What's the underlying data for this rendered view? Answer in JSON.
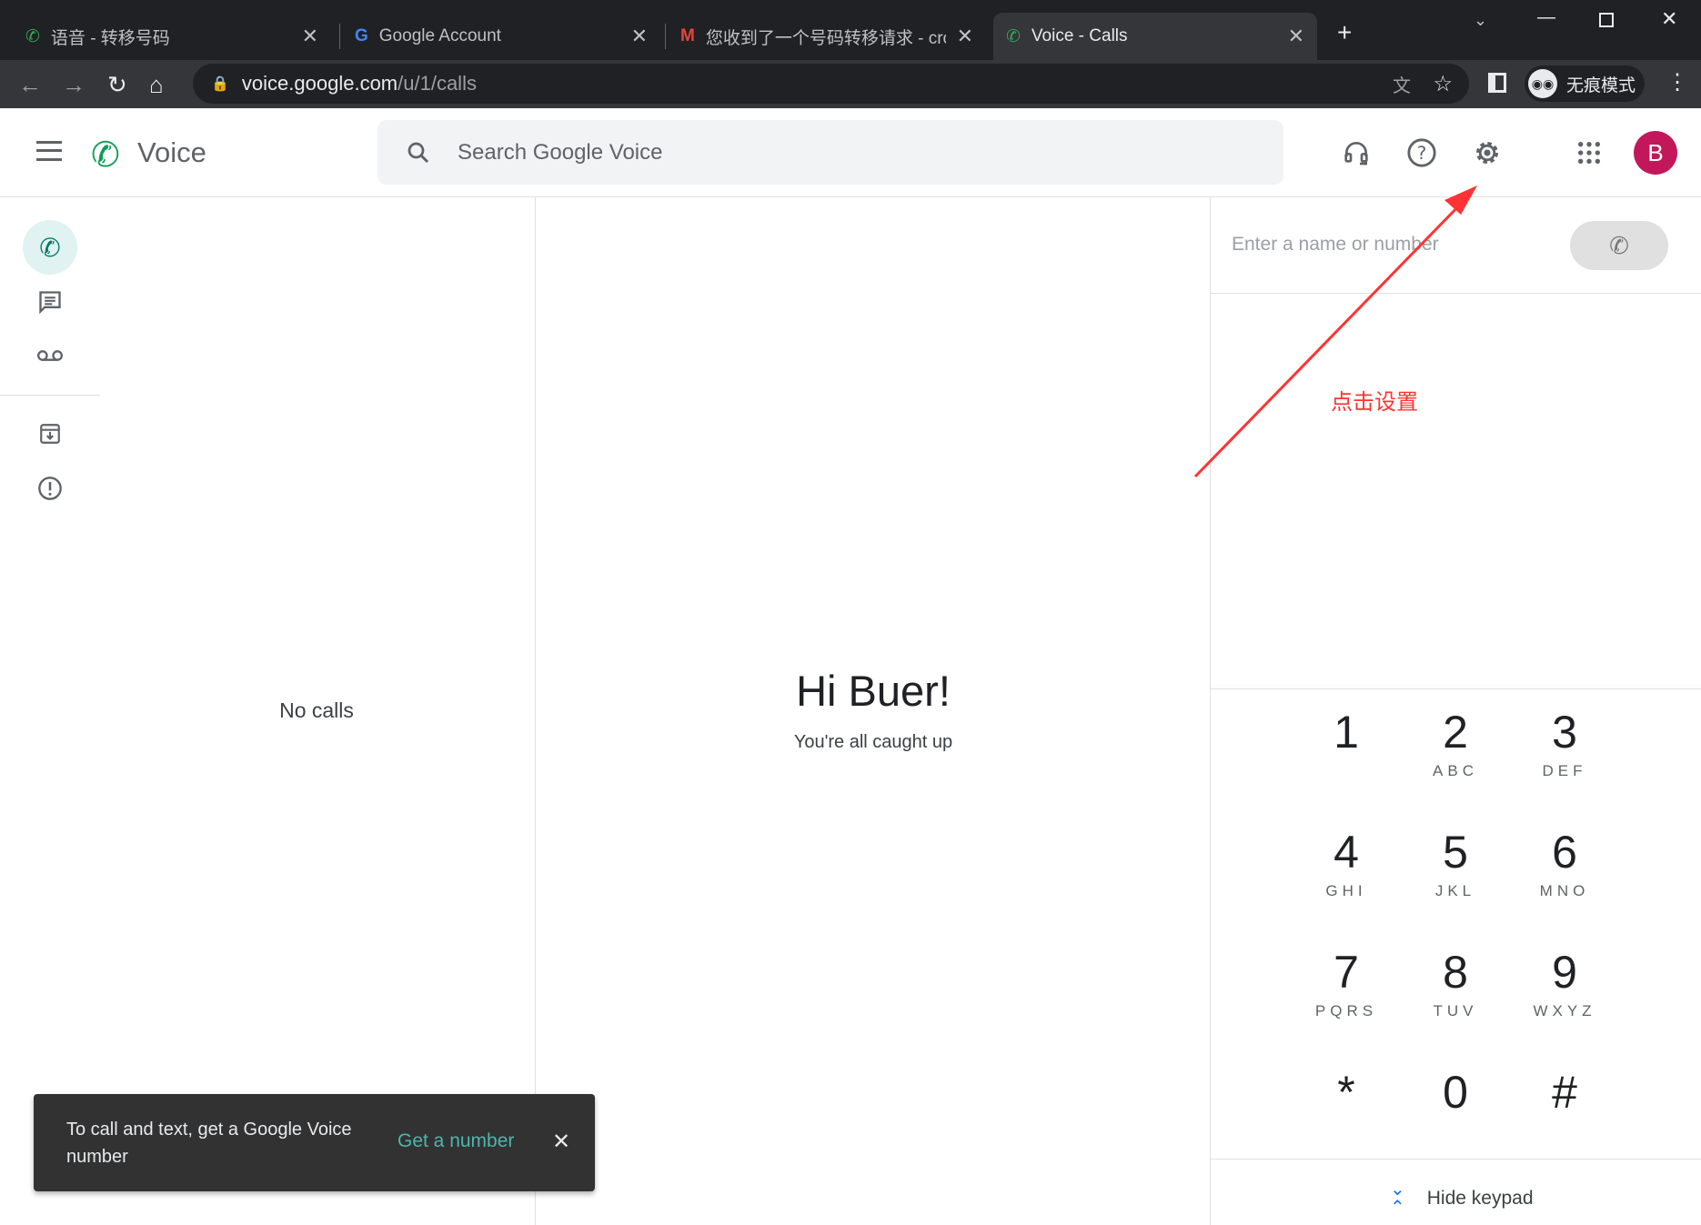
{
  "browser": {
    "tabs": [
      {
        "title": "语音 - 转移号码",
        "icon": "google-voice-icon"
      },
      {
        "title": "Google Account",
        "icon": "google-g-icon"
      },
      {
        "title": "您收到了一个号码转移请求 - cro",
        "icon": "gmail-icon"
      },
      {
        "title": "Voice - Calls",
        "icon": "google-voice-icon",
        "active": true
      }
    ],
    "url_host": "voice.google.com",
    "url_path": "/u/1/calls",
    "incognito_label": "无痕模式"
  },
  "app": {
    "name": "Voice",
    "search_placeholder": "Search Google Voice",
    "avatar_letter": "B",
    "avatar_color": "#c2185b",
    "accent": "#00796b"
  },
  "calls": {
    "empty": "No calls"
  },
  "main": {
    "greeting": "Hi Buer!",
    "subtitle": "You're all caught up"
  },
  "dialer": {
    "placeholder": "Enter a name or number",
    "hide_keypad": "Hide keypad",
    "keys": [
      {
        "d": "1",
        "l": ""
      },
      {
        "d": "2",
        "l": "ABC"
      },
      {
        "d": "3",
        "l": "DEF"
      },
      {
        "d": "4",
        "l": "GHI"
      },
      {
        "d": "5",
        "l": "JKL"
      },
      {
        "d": "6",
        "l": "MNO"
      },
      {
        "d": "7",
        "l": "PQRS"
      },
      {
        "d": "8",
        "l": "TUV"
      },
      {
        "d": "9",
        "l": "WXYZ"
      },
      {
        "d": "*",
        "l": ""
      },
      {
        "d": "0",
        "l": ""
      },
      {
        "d": "#",
        "l": ""
      }
    ]
  },
  "snackbar": {
    "text": "To call and text, get a Google Voice number",
    "action": "Get a number"
  },
  "annotation": {
    "text": "点击设置",
    "color": "#ff3333"
  }
}
